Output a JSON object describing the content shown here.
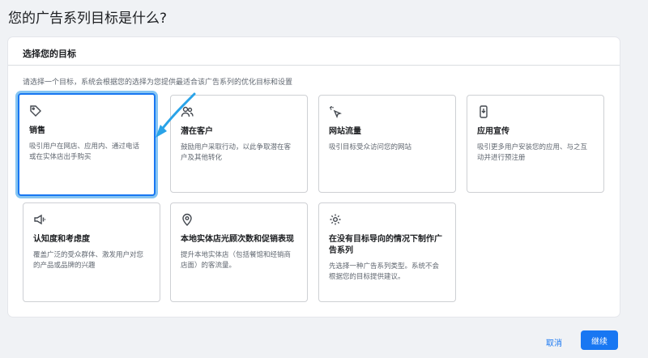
{
  "page": {
    "title": "您的广告系列目标是什么?"
  },
  "panel": {
    "title": "选择您的目标",
    "instruction": "请选择一个目标，系统会根据您的选择为您提供最适合该广告系列的优化目标和设置"
  },
  "objectives": [
    {
      "icon": "tag-icon",
      "title": "销售",
      "desc": "吸引用户在网店、应用内、通过电话或在实体店出手购买",
      "selected": true
    },
    {
      "icon": "people-icon",
      "title": "潜在客户",
      "desc": "鼓励用户采取行动，以此争取潜在客户及其他转化"
    },
    {
      "icon": "cursor-click-icon",
      "title": "网站流量",
      "desc": "吸引目标受众访问您的网站"
    },
    {
      "icon": "phone-download-icon",
      "title": "应用宣传",
      "desc": "吸引更多用户安装您的应用、与之互动并进行预注册"
    },
    {
      "icon": "megaphone-icon",
      "title": "认知度和考虑度",
      "desc": "覆盖广泛的受众群体、激发用户对您的产品或品牌的兴趣"
    },
    {
      "icon": "location-pin-icon",
      "title": "本地实体店光顾次数和促销表现",
      "desc": "提升本地实体店（包括餐馆和经销商店面）的客流量。"
    },
    {
      "icon": "gear-icon",
      "title": "在没有目标导向的情况下制作广告系列",
      "desc": "先选择一种广告系列类型。系统不会根据您的目标提供建议。"
    }
  ],
  "footer": {
    "cancel_label": "取消",
    "continue_label": "继续"
  },
  "colors": {
    "accent": "#1877f2",
    "highlight": "#86c5f2"
  }
}
